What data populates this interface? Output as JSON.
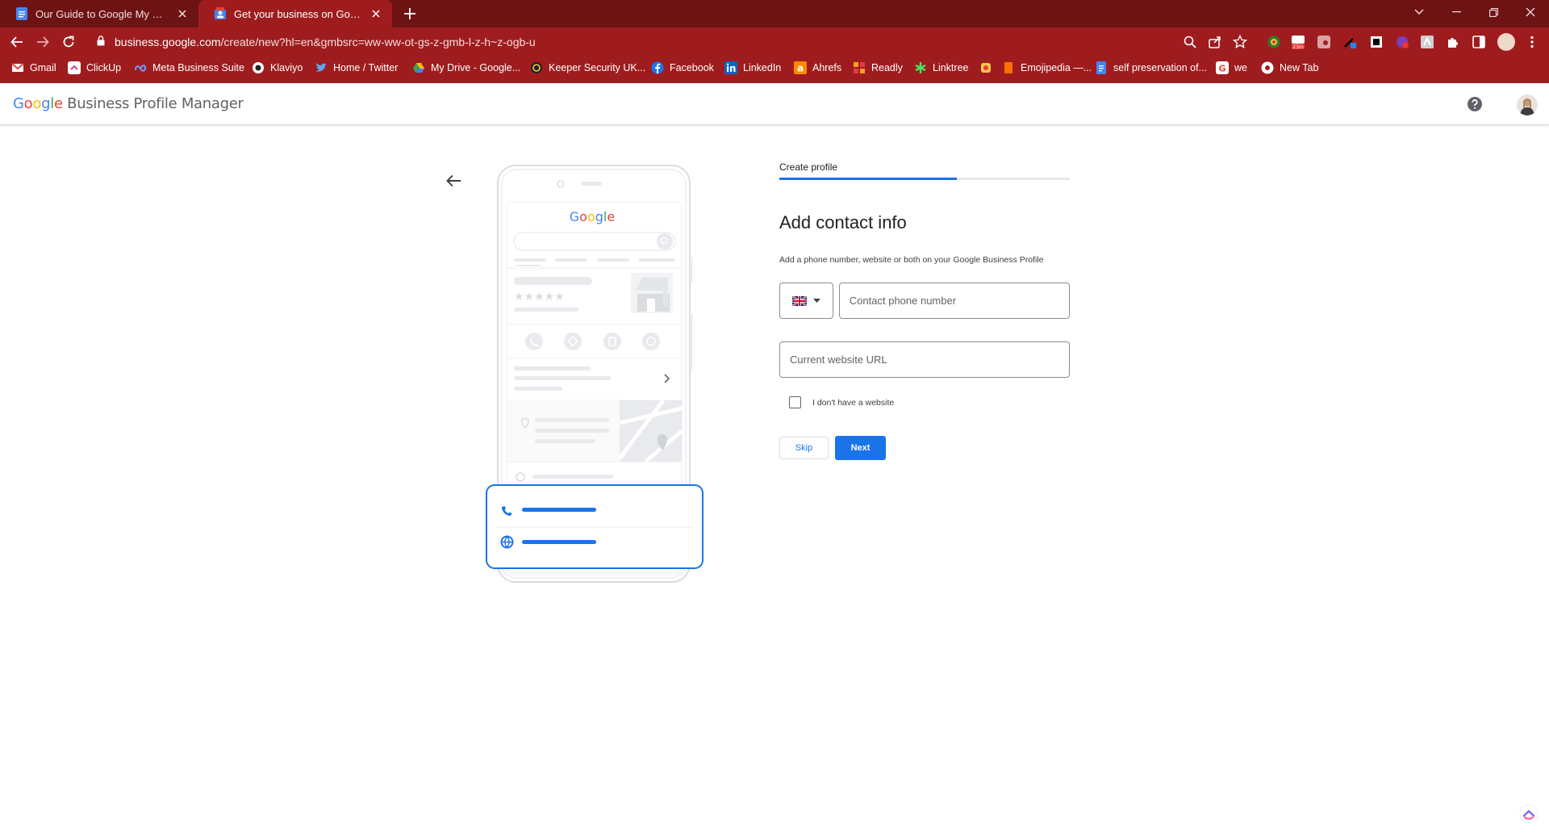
{
  "browser": {
    "tabs": [
      {
        "title": "Our Guide to Google My Business",
        "icon": "docs-icon",
        "active": false
      },
      {
        "title": "Get your business on Google",
        "icon": "business-profile-icon",
        "active": true
      }
    ],
    "url_host": "business.google.com",
    "url_path": "/create/new?hl=en&gmbsrc=ww-ww-ot-gs-z-gmb-l-z-h~z-ogb-u",
    "extension_badge": "23m",
    "bookmarks": [
      {
        "label": "Gmail",
        "icon": "gmail-icon"
      },
      {
        "label": "ClickUp",
        "icon": "clickup-icon"
      },
      {
        "label": "Meta Business Suite",
        "icon": "meta-icon"
      },
      {
        "label": "Klaviyo",
        "icon": "klaviyo-icon"
      },
      {
        "label": "Home / Twitter",
        "icon": "twitter-icon"
      },
      {
        "label": "My Drive - Google...",
        "icon": "drive-icon"
      },
      {
        "label": "Keeper Security UK...",
        "icon": "keeper-icon"
      },
      {
        "label": "Facebook",
        "icon": "facebook-icon"
      },
      {
        "label": "LinkedIn",
        "icon": "linkedin-icon"
      },
      {
        "label": "Ahrefs",
        "icon": "ahrefs-icon"
      },
      {
        "label": "Readly",
        "icon": "readly-icon"
      },
      {
        "label": "Linktree",
        "icon": "linktree-icon"
      },
      {
        "label": "",
        "icon": "extension-bookmark-icon"
      },
      {
        "label": "Emojipedia —...",
        "icon": "emojipedia-icon"
      },
      {
        "label": "self preservation of...",
        "icon": "docs-icon"
      },
      {
        "label": "we",
        "icon": "google-icon"
      },
      {
        "label": "New Tab",
        "icon": "chrome-icon"
      }
    ]
  },
  "app": {
    "logo_google": "Google",
    "logo_product": "Business Profile Manager"
  },
  "form": {
    "step_label": "Create profile",
    "progress": 0.61,
    "title": "Add contact info",
    "description": "Add a phone number, website or both on your Google Business Profile",
    "country": "United Kingdom",
    "phone_placeholder": "Contact phone number",
    "phone_value": "",
    "website_placeholder": "Current website URL",
    "website_value": "",
    "no_website_label": "I don't have a website",
    "no_website_checked": false,
    "skip_label": "Skip",
    "next_label": "Next"
  },
  "illustration": {
    "search_logo": "Google"
  },
  "colors": {
    "chrome_dark": "#6e1314",
    "chrome": "#9f1c1e",
    "accent": "#1a73e8"
  }
}
